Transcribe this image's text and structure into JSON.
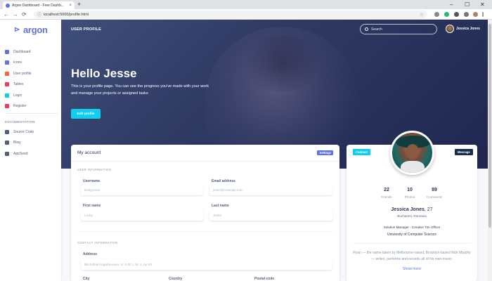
{
  "browser": {
    "tab_title": "Argon Dashboard - Free Dashb...",
    "tab_close": "×",
    "new_tab": "+",
    "url": "localhost:5000/profile.html",
    "back": "←",
    "forward": "→",
    "reload": "⟳",
    "info": "ⓘ",
    "star": "☆",
    "minimize": "–",
    "maximize": "☐",
    "close": "✕"
  },
  "sidebar": {
    "brand": "argon",
    "items": [
      {
        "label": "Dashboard",
        "color": "#5e72e4"
      },
      {
        "label": "Icons",
        "color": "#5e72e4"
      },
      {
        "label": "User profile",
        "color": "#fb6340"
      },
      {
        "label": "Tables",
        "color": "#f5365c"
      },
      {
        "label": "Login",
        "color": "#11cdef"
      },
      {
        "label": "Register",
        "color": "#f5365c"
      }
    ],
    "doc_heading": "DOCUMENTATION",
    "doc_items": [
      {
        "label": "Source Code",
        "color": "#525f7f"
      },
      {
        "label": "Blog",
        "color": "#525f7f"
      },
      {
        "label": "AppSeed",
        "color": "#525f7f"
      }
    ]
  },
  "header": {
    "page_title": "USER PROFILE",
    "search_placeholder": "Search",
    "user_name": "Jessica Jones"
  },
  "hero": {
    "greeting": "Hello Jesse",
    "intro": "This is your profile page. You can see the progress you've made with your work and manage your projects or assigned tasks",
    "edit_button": "Edit profile"
  },
  "account": {
    "title": "My account",
    "settings_button": "Settings",
    "user_info_label": "USER INFORMATION",
    "username_label": "Username",
    "username_value": "lucky.jesse",
    "email_label": "Email address",
    "email_value": "jesse@example.com",
    "first_name_label": "First name",
    "first_name_value": "Lucky",
    "last_name_label": "Last name",
    "last_name_value": "Jesse",
    "contact_label": "CONTACT INFORMATION",
    "address_label": "Address",
    "address_value": "Bld Mihail Kogalniceanu, nr. 8 Bl 1, Sc 1, Ap 09",
    "city_label": "City",
    "country_label": "Country",
    "postal_label": "Postal code"
  },
  "profile": {
    "connect_button": "Connect",
    "message_button": "Message",
    "stats": [
      {
        "value": "22",
        "label": "Friends"
      },
      {
        "value": "10",
        "label": "Photos"
      },
      {
        "value": "89",
        "label": "Comments"
      }
    ],
    "name": "Jessica Jones",
    "age": ", 27",
    "location": "Bucharest, Romania",
    "job": "Solution Manager - Creative Tim Officer",
    "education": "University of Computer Science",
    "bio": "Ryan — the name taken by Melbourne-raised, Brooklyn-based Nick Murphy — writes, performs and records all of his own music.",
    "show_more": "Show more"
  },
  "colors": {
    "primary": "#5e72e4",
    "info": "#11cdef",
    "dark": "#172b4d"
  }
}
